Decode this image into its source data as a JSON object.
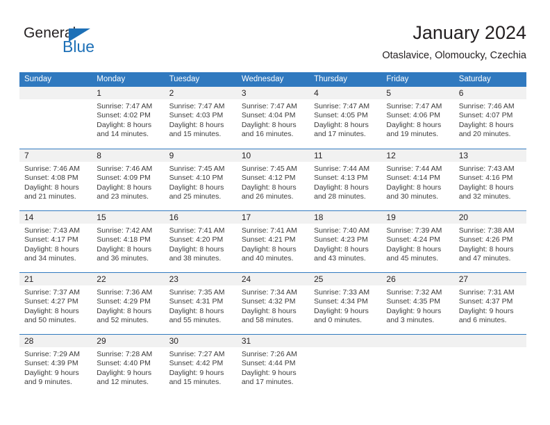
{
  "brand": {
    "name_top": "General",
    "name_bottom": "Blue",
    "accent_color": "#1d70b7",
    "triangle_icon": "triangle-icon"
  },
  "header": {
    "title": "January 2024",
    "subtitle": "Otaslavice, Olomoucky, Czechia"
  },
  "calendar": {
    "header_bg": "#3079bf",
    "header_text_color": "#ffffff",
    "daynum_bg": "#f1f1f1",
    "weekday_headers": [
      "Sunday",
      "Monday",
      "Tuesday",
      "Wednesday",
      "Thursday",
      "Friday",
      "Saturday"
    ],
    "weeks": [
      [
        {
          "day": "",
          "sunrise": "",
          "sunset": "",
          "daylight1": "",
          "daylight2": ""
        },
        {
          "day": "1",
          "sunrise": "Sunrise: 7:47 AM",
          "sunset": "Sunset: 4:02 PM",
          "daylight1": "Daylight: 8 hours",
          "daylight2": "and 14 minutes."
        },
        {
          "day": "2",
          "sunrise": "Sunrise: 7:47 AM",
          "sunset": "Sunset: 4:03 PM",
          "daylight1": "Daylight: 8 hours",
          "daylight2": "and 15 minutes."
        },
        {
          "day": "3",
          "sunrise": "Sunrise: 7:47 AM",
          "sunset": "Sunset: 4:04 PM",
          "daylight1": "Daylight: 8 hours",
          "daylight2": "and 16 minutes."
        },
        {
          "day": "4",
          "sunrise": "Sunrise: 7:47 AM",
          "sunset": "Sunset: 4:05 PM",
          "daylight1": "Daylight: 8 hours",
          "daylight2": "and 17 minutes."
        },
        {
          "day": "5",
          "sunrise": "Sunrise: 7:47 AM",
          "sunset": "Sunset: 4:06 PM",
          "daylight1": "Daylight: 8 hours",
          "daylight2": "and 19 minutes."
        },
        {
          "day": "6",
          "sunrise": "Sunrise: 7:46 AM",
          "sunset": "Sunset: 4:07 PM",
          "daylight1": "Daylight: 8 hours",
          "daylight2": "and 20 minutes."
        }
      ],
      [
        {
          "day": "7",
          "sunrise": "Sunrise: 7:46 AM",
          "sunset": "Sunset: 4:08 PM",
          "daylight1": "Daylight: 8 hours",
          "daylight2": "and 21 minutes."
        },
        {
          "day": "8",
          "sunrise": "Sunrise: 7:46 AM",
          "sunset": "Sunset: 4:09 PM",
          "daylight1": "Daylight: 8 hours",
          "daylight2": "and 23 minutes."
        },
        {
          "day": "9",
          "sunrise": "Sunrise: 7:45 AM",
          "sunset": "Sunset: 4:10 PM",
          "daylight1": "Daylight: 8 hours",
          "daylight2": "and 25 minutes."
        },
        {
          "day": "10",
          "sunrise": "Sunrise: 7:45 AM",
          "sunset": "Sunset: 4:12 PM",
          "daylight1": "Daylight: 8 hours",
          "daylight2": "and 26 minutes."
        },
        {
          "day": "11",
          "sunrise": "Sunrise: 7:44 AM",
          "sunset": "Sunset: 4:13 PM",
          "daylight1": "Daylight: 8 hours",
          "daylight2": "and 28 minutes."
        },
        {
          "day": "12",
          "sunrise": "Sunrise: 7:44 AM",
          "sunset": "Sunset: 4:14 PM",
          "daylight1": "Daylight: 8 hours",
          "daylight2": "and 30 minutes."
        },
        {
          "day": "13",
          "sunrise": "Sunrise: 7:43 AM",
          "sunset": "Sunset: 4:16 PM",
          "daylight1": "Daylight: 8 hours",
          "daylight2": "and 32 minutes."
        }
      ],
      [
        {
          "day": "14",
          "sunrise": "Sunrise: 7:43 AM",
          "sunset": "Sunset: 4:17 PM",
          "daylight1": "Daylight: 8 hours",
          "daylight2": "and 34 minutes."
        },
        {
          "day": "15",
          "sunrise": "Sunrise: 7:42 AM",
          "sunset": "Sunset: 4:18 PM",
          "daylight1": "Daylight: 8 hours",
          "daylight2": "and 36 minutes."
        },
        {
          "day": "16",
          "sunrise": "Sunrise: 7:41 AM",
          "sunset": "Sunset: 4:20 PM",
          "daylight1": "Daylight: 8 hours",
          "daylight2": "and 38 minutes."
        },
        {
          "day": "17",
          "sunrise": "Sunrise: 7:41 AM",
          "sunset": "Sunset: 4:21 PM",
          "daylight1": "Daylight: 8 hours",
          "daylight2": "and 40 minutes."
        },
        {
          "day": "18",
          "sunrise": "Sunrise: 7:40 AM",
          "sunset": "Sunset: 4:23 PM",
          "daylight1": "Daylight: 8 hours",
          "daylight2": "and 43 minutes."
        },
        {
          "day": "19",
          "sunrise": "Sunrise: 7:39 AM",
          "sunset": "Sunset: 4:24 PM",
          "daylight1": "Daylight: 8 hours",
          "daylight2": "and 45 minutes."
        },
        {
          "day": "20",
          "sunrise": "Sunrise: 7:38 AM",
          "sunset": "Sunset: 4:26 PM",
          "daylight1": "Daylight: 8 hours",
          "daylight2": "and 47 minutes."
        }
      ],
      [
        {
          "day": "21",
          "sunrise": "Sunrise: 7:37 AM",
          "sunset": "Sunset: 4:27 PM",
          "daylight1": "Daylight: 8 hours",
          "daylight2": "and 50 minutes."
        },
        {
          "day": "22",
          "sunrise": "Sunrise: 7:36 AM",
          "sunset": "Sunset: 4:29 PM",
          "daylight1": "Daylight: 8 hours",
          "daylight2": "and 52 minutes."
        },
        {
          "day": "23",
          "sunrise": "Sunrise: 7:35 AM",
          "sunset": "Sunset: 4:31 PM",
          "daylight1": "Daylight: 8 hours",
          "daylight2": "and 55 minutes."
        },
        {
          "day": "24",
          "sunrise": "Sunrise: 7:34 AM",
          "sunset": "Sunset: 4:32 PM",
          "daylight1": "Daylight: 8 hours",
          "daylight2": "and 58 minutes."
        },
        {
          "day": "25",
          "sunrise": "Sunrise: 7:33 AM",
          "sunset": "Sunset: 4:34 PM",
          "daylight1": "Daylight: 9 hours",
          "daylight2": "and 0 minutes."
        },
        {
          "day": "26",
          "sunrise": "Sunrise: 7:32 AM",
          "sunset": "Sunset: 4:35 PM",
          "daylight1": "Daylight: 9 hours",
          "daylight2": "and 3 minutes."
        },
        {
          "day": "27",
          "sunrise": "Sunrise: 7:31 AM",
          "sunset": "Sunset: 4:37 PM",
          "daylight1": "Daylight: 9 hours",
          "daylight2": "and 6 minutes."
        }
      ],
      [
        {
          "day": "28",
          "sunrise": "Sunrise: 7:29 AM",
          "sunset": "Sunset: 4:39 PM",
          "daylight1": "Daylight: 9 hours",
          "daylight2": "and 9 minutes."
        },
        {
          "day": "29",
          "sunrise": "Sunrise: 7:28 AM",
          "sunset": "Sunset: 4:40 PM",
          "daylight1": "Daylight: 9 hours",
          "daylight2": "and 12 minutes."
        },
        {
          "day": "30",
          "sunrise": "Sunrise: 7:27 AM",
          "sunset": "Sunset: 4:42 PM",
          "daylight1": "Daylight: 9 hours",
          "daylight2": "and 15 minutes."
        },
        {
          "day": "31",
          "sunrise": "Sunrise: 7:26 AM",
          "sunset": "Sunset: 4:44 PM",
          "daylight1": "Daylight: 9 hours",
          "daylight2": "and 17 minutes."
        },
        {
          "day": "",
          "sunrise": "",
          "sunset": "",
          "daylight1": "",
          "daylight2": ""
        },
        {
          "day": "",
          "sunrise": "",
          "sunset": "",
          "daylight1": "",
          "daylight2": ""
        },
        {
          "day": "",
          "sunrise": "",
          "sunset": "",
          "daylight1": "",
          "daylight2": ""
        }
      ]
    ]
  }
}
